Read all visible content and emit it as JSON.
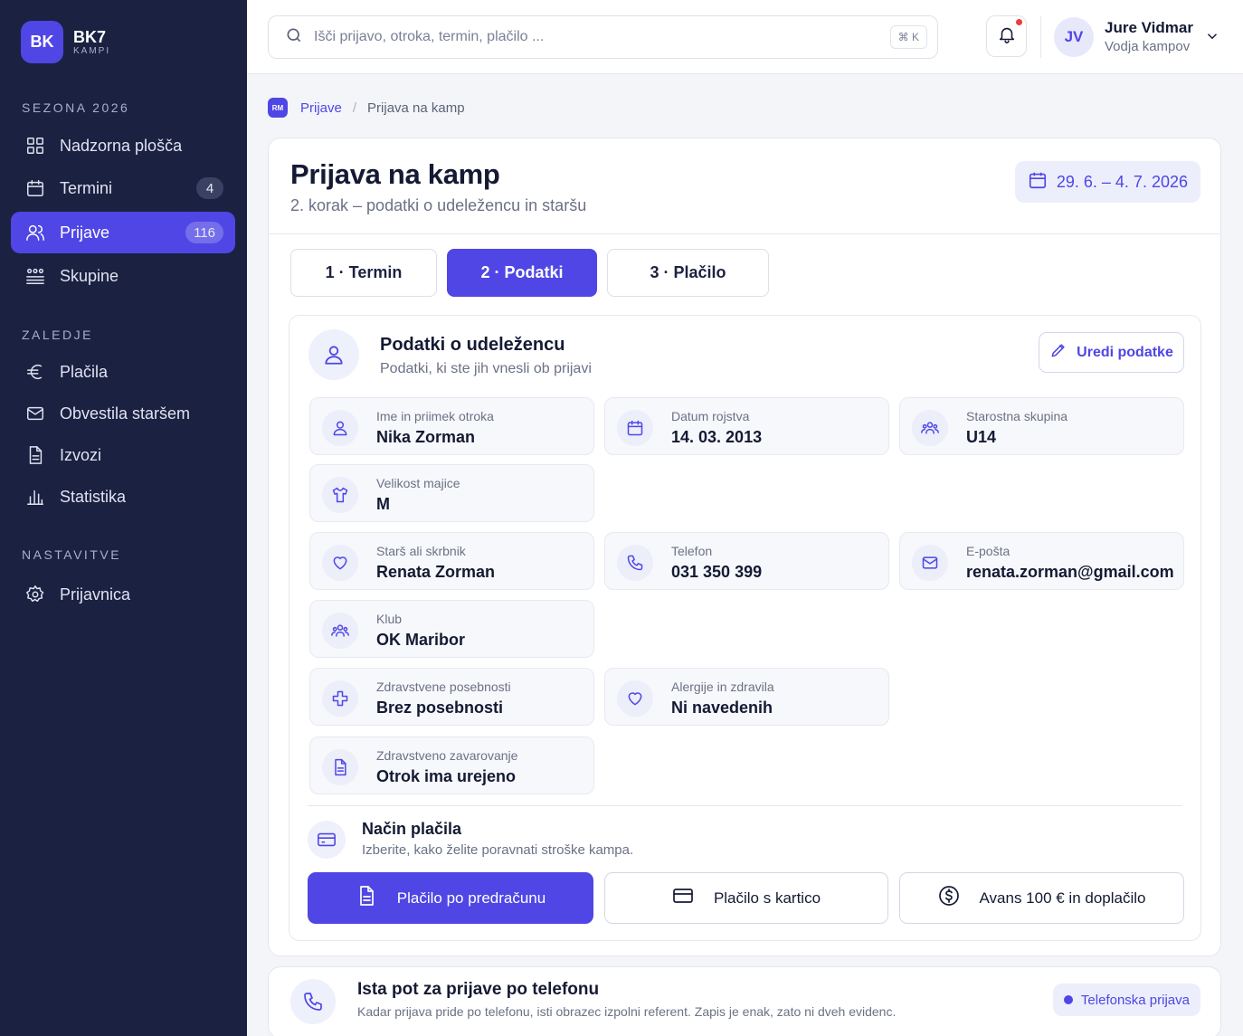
{
  "brand": {
    "logo": "BK",
    "name": "BK7",
    "sub": "KAMPI"
  },
  "sidebar": {
    "sections": [
      {
        "label": "SEZONA 2026"
      },
      {
        "label": "ZALEDJE"
      },
      {
        "label": "NASTAVITVE"
      }
    ],
    "items": [
      {
        "label": "Nadzorna plošča",
        "icon": "dashboard-grid-icon"
      },
      {
        "label": "Termini",
        "icon": "calendar-icon",
        "badge": "4"
      },
      {
        "label": "Prijave",
        "icon": "users-icon",
        "badge": "116",
        "active": true
      },
      {
        "label": "Skupine",
        "icon": "groups-icon"
      },
      {
        "label": "Plačila",
        "icon": "euro-icon"
      },
      {
        "label": "Obvestila staršem",
        "icon": "mail-icon"
      },
      {
        "label": "Izvozi",
        "icon": "document-icon"
      },
      {
        "label": "Statistika",
        "icon": "bar-chart-icon"
      },
      {
        "label": "Prijavnica",
        "icon": "gear-icon"
      }
    ]
  },
  "search": {
    "placeholder": "Išči prijavo, otroka, termin, plačilo ...",
    "shortcut": "⌘ K"
  },
  "user": {
    "initials": "JV",
    "name": "Jure Vidmar",
    "role": "Vodja kampov"
  },
  "breadcrumb": {
    "logo": "RM",
    "parent": "Prijave",
    "separator": "/",
    "current": "Prijava na kamp"
  },
  "page": {
    "title": "Prijava na kamp",
    "subtitle": "2. korak – podatki o udeležencu in staršu",
    "date_range": "29. 6. – 4. 7. 2026"
  },
  "steps": [
    {
      "label": "1 · Termin"
    },
    {
      "label": "2 · Podatki",
      "active": true
    },
    {
      "label": "3 · Plačilo"
    }
  ],
  "participant": {
    "title": "Podatki o udeležencu",
    "subtitle": "Podatki, ki ste jih vnesli ob prijavi",
    "edit_label": "Uredi podatke",
    "fields": [
      {
        "label": "Ime in priimek otroka",
        "value": "Nika Zorman",
        "icon": "user-icon"
      },
      {
        "label": "Datum rojstva",
        "value": "14. 03. 2013",
        "icon": "calendar-icon"
      },
      {
        "label": "Starostna skupina",
        "value": "U14",
        "icon": "group-icon"
      },
      {
        "label": "Velikost majice",
        "value": "M",
        "icon": "shirt-icon"
      },
      {
        "label": "Starš ali skrbnik",
        "value": "Renata Zorman",
        "icon": "heart-icon"
      },
      {
        "label": "Telefon",
        "value": "031 350 399",
        "icon": "phone-icon"
      },
      {
        "label": "E-pošta",
        "value": "renata.zorman@gmail.com",
        "icon": "mail-icon"
      },
      {
        "label": "Klub",
        "value": "OK Maribor",
        "icon": "group-icon"
      },
      {
        "label": "Zdravstvene posebnosti",
        "value": "Brez posebnosti",
        "icon": "medical-cross-icon"
      },
      {
        "label": "Alergije in zdravila",
        "value": "Ni navedenih",
        "icon": "heart-icon"
      },
      {
        "label": "Zdravstveno zavarovanje",
        "value": "Otrok ima urejeno",
        "icon": "document-icon"
      }
    ]
  },
  "payment": {
    "title": "Način plačila",
    "subtitle": "Izberite, kako želite poravnati stroške kampa.",
    "options": [
      {
        "label": "Plačilo po predračunu",
        "icon": "document-icon",
        "active": true
      },
      {
        "label": "Plačilo s kartico",
        "icon": "credit-card-icon"
      },
      {
        "label": "Avans 100 € in doplačilo",
        "icon": "dollar-coin-icon"
      }
    ]
  },
  "phone_card": {
    "title": "Ista pot za prijave po telefonu",
    "subtitle": "Kadar prijava pride po telefonu, isti obrazec izpolni referent. Zapis je enak, zato ni dveh evidenc.",
    "tag": "Telefonska prijava"
  },
  "colors": {
    "accent": "#4f46e5",
    "sidebar_bg": "#1b2140",
    "notification": "#ef3b3b"
  }
}
